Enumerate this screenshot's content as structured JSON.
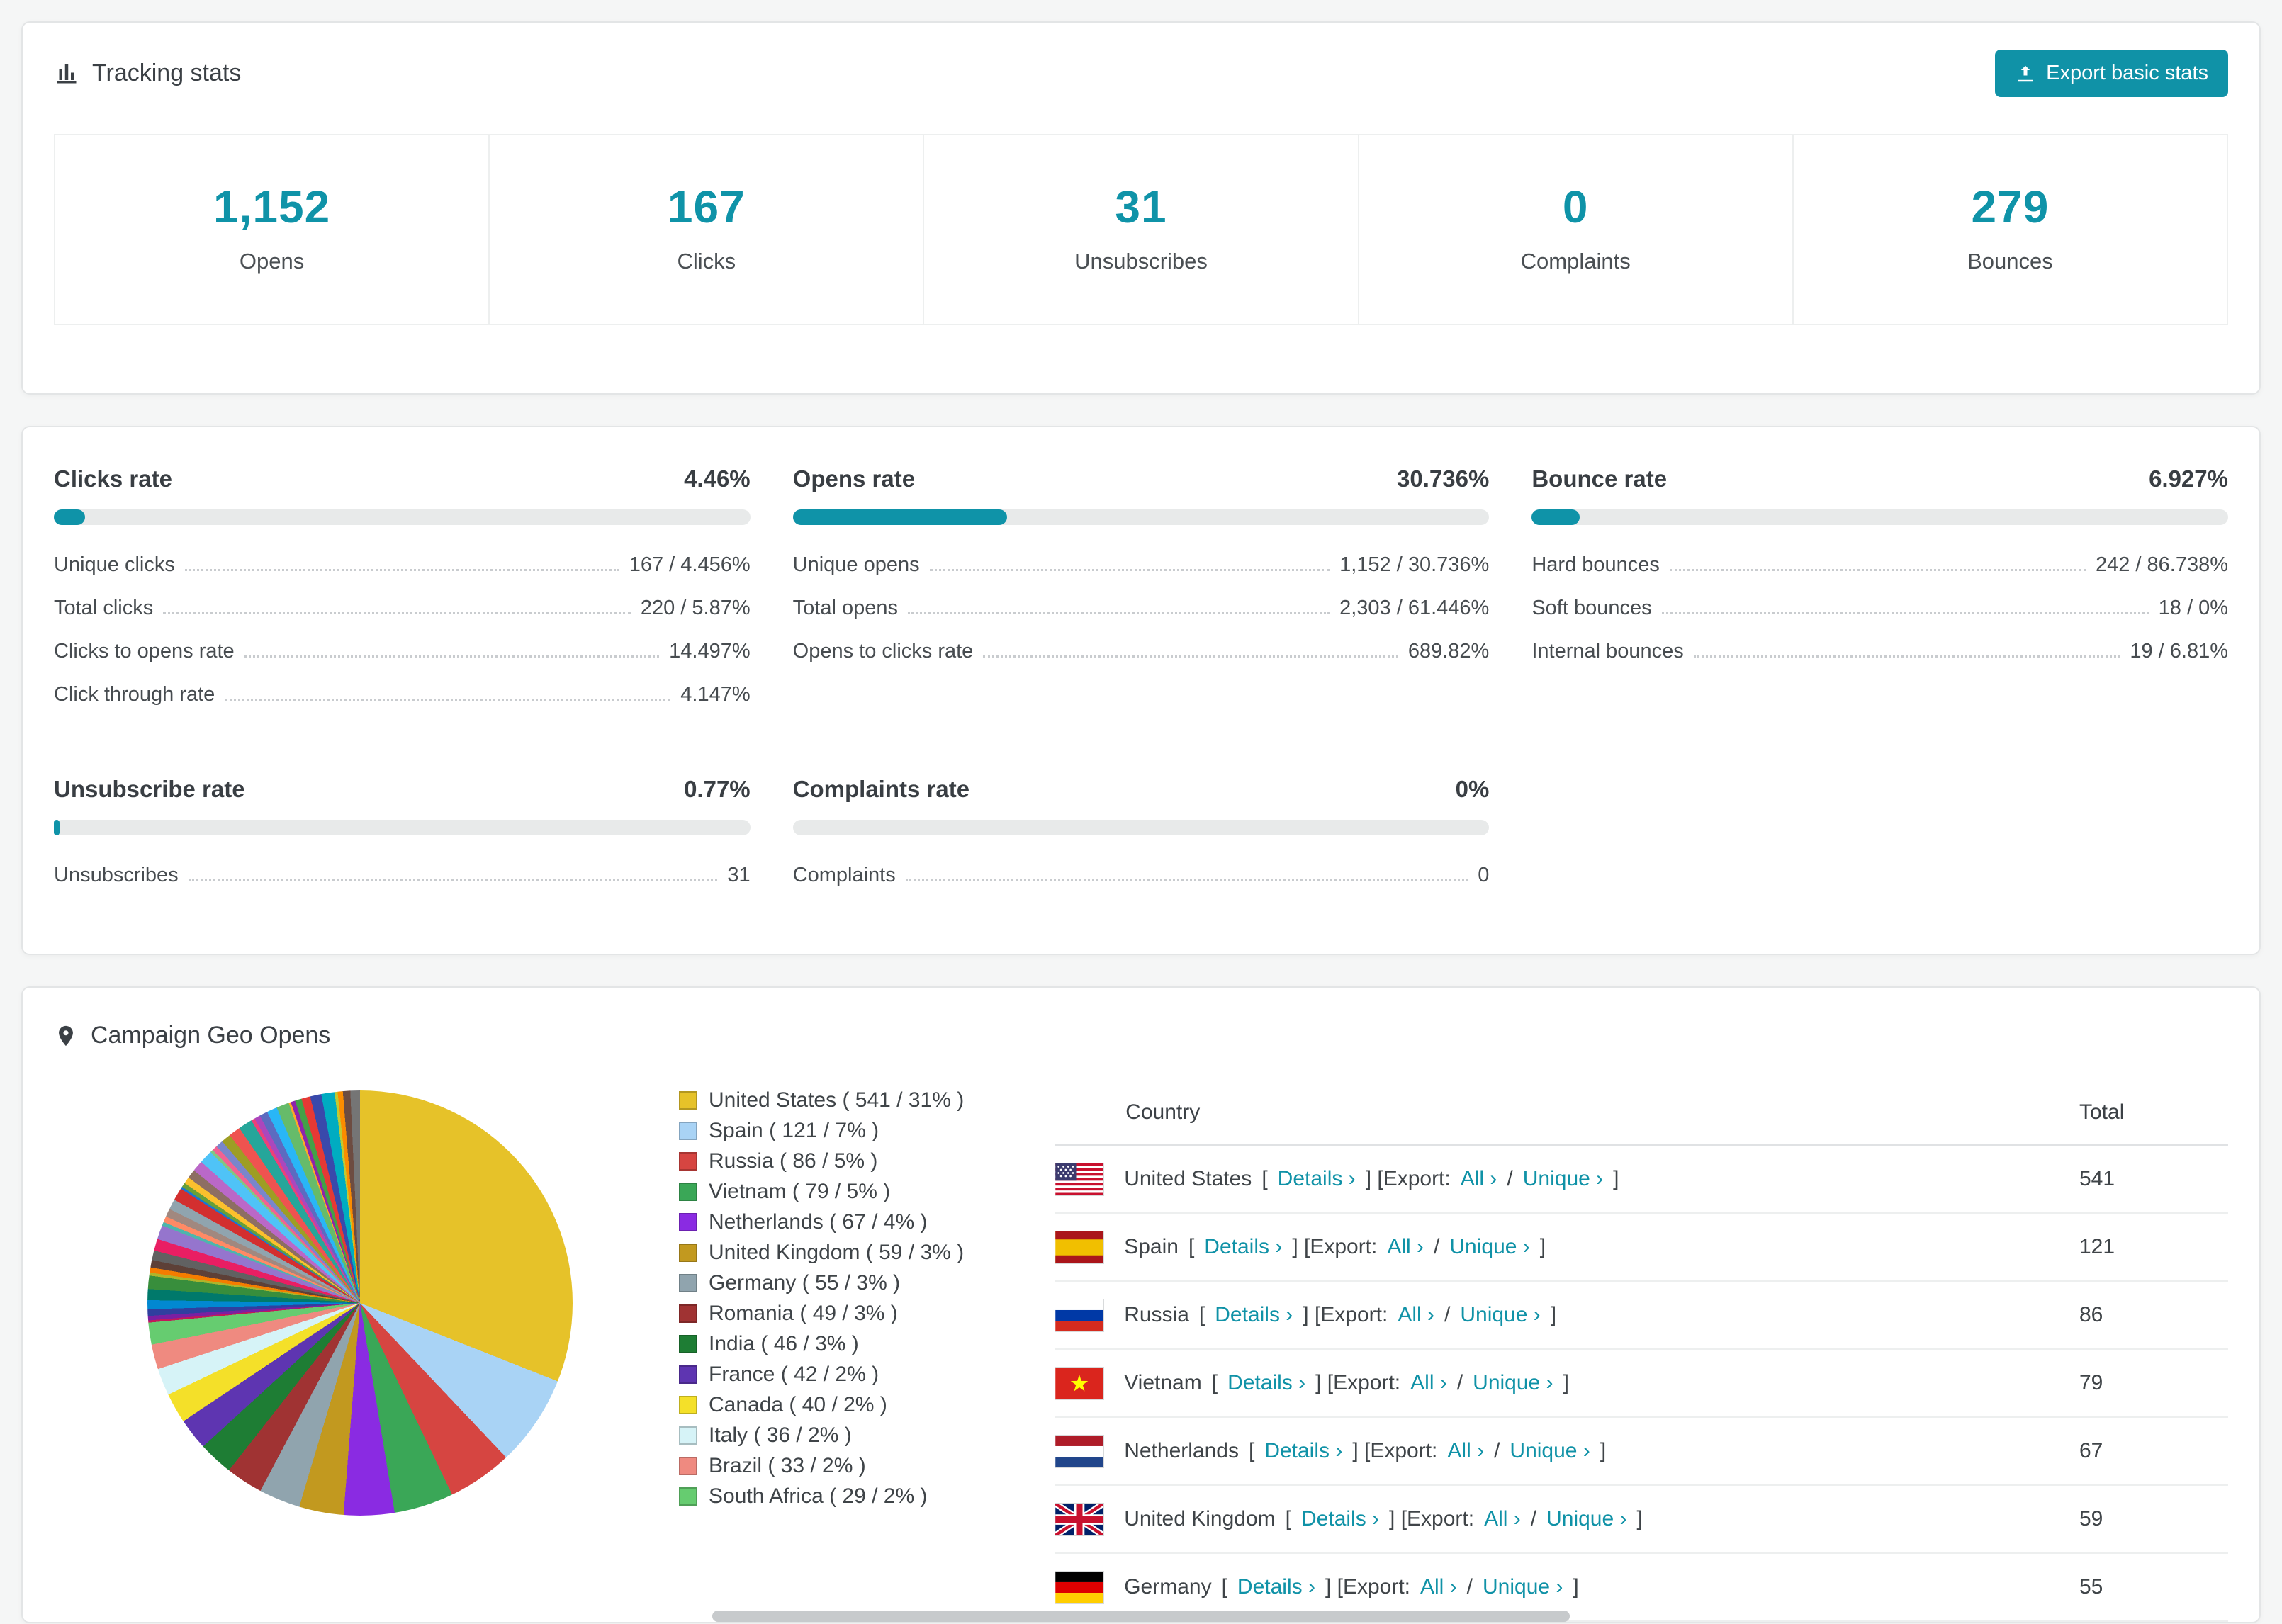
{
  "accent_color": "#1092a7",
  "tracking": {
    "title": "Tracking stats",
    "export_label": "Export basic stats",
    "stats": [
      {
        "value": "1,152",
        "label": "Opens"
      },
      {
        "value": "167",
        "label": "Clicks"
      },
      {
        "value": "31",
        "label": "Unsubscribes"
      },
      {
        "value": "0",
        "label": "Complaints"
      },
      {
        "value": "279",
        "label": "Bounces"
      }
    ]
  },
  "rates": [
    {
      "title": "Clicks rate",
      "percent_label": "4.46%",
      "percent": 4.46,
      "rows": [
        {
          "label": "Unique clicks",
          "value": "167 / 4.456%"
        },
        {
          "label": "Total clicks",
          "value": "220 / 5.87%"
        },
        {
          "label": "Clicks to opens rate",
          "value": "14.497%"
        },
        {
          "label": "Click through rate",
          "value": "4.147%"
        }
      ]
    },
    {
      "title": "Opens rate",
      "percent_label": "30.736%",
      "percent": 30.736,
      "rows": [
        {
          "label": "Unique opens",
          "value": "1,152 / 30.736%"
        },
        {
          "label": "Total opens",
          "value": "2,303 / 61.446%"
        },
        {
          "label": "Opens to clicks rate",
          "value": "689.82%"
        }
      ]
    },
    {
      "title": "Bounce rate",
      "percent_label": "6.927%",
      "percent": 6.927,
      "rows": [
        {
          "label": "Hard bounces",
          "value": "242 / 86.738%"
        },
        {
          "label": "Soft bounces",
          "value": "18 / 0%"
        },
        {
          "label": "Internal bounces",
          "value": "19 / 6.81%"
        }
      ]
    },
    {
      "title": "Unsubscribe rate",
      "percent_label": "0.77%",
      "percent": 0.77,
      "rows": [
        {
          "label": "Unsubscribes",
          "value": "31"
        }
      ]
    },
    {
      "title": "Complaints rate",
      "percent_label": "0%",
      "percent": 0,
      "rows": [
        {
          "label": "Complaints",
          "value": "0"
        }
      ]
    }
  ],
  "geo": {
    "title": "Campaign Geo Opens",
    "chart_data": {
      "type": "pie",
      "title": "Campaign Geo Opens",
      "categories": [
        "United States",
        "Spain",
        "Russia",
        "Vietnam",
        "Netherlands",
        "United Kingdom",
        "Germany",
        "Romania",
        "India",
        "France",
        "Canada",
        "Italy",
        "Brazil",
        "South Africa"
      ],
      "values": [
        541,
        121,
        86,
        79,
        67,
        59,
        55,
        49,
        46,
        42,
        40,
        36,
        33,
        29
      ],
      "percents": [
        31,
        7,
        5,
        5,
        4,
        3,
        3,
        3,
        3,
        2,
        2,
        2,
        2,
        2
      ],
      "colors": [
        "#e6c229",
        "#a9d3f5",
        "#d64541",
        "#3aa757",
        "#8a2be2",
        "#c2991f",
        "#90a4ae",
        "#a03333",
        "#1e7d34",
        "#5e35b1",
        "#f4e029",
        "#d6f3f7",
        "#ef8a80",
        "#66cc70"
      ],
      "legend_position": "right",
      "start_angle_deg": 0,
      "other": {
        "total": 462,
        "slice_count": 44,
        "note": "many small unlabeled slices"
      },
      "other_palette": [
        "#c2185b",
        "#7b1fa2",
        "#303f9f",
        "#0288d1",
        "#00796b",
        "#388e3c",
        "#afb42b",
        "#f57c00",
        "#5d4037",
        "#616161",
        "#e91e63",
        "#9575cd",
        "#4db6ac",
        "#ff8a65",
        "#a1887f",
        "#90a4ae",
        "#d32f2f",
        "#1976d2",
        "#689f38",
        "#fbc02d",
        "#8d6e63",
        "#ba68c8",
        "#4fc3f7",
        "#81c784",
        "#f06292",
        "#7986cb",
        "#9e9d24",
        "#ef5350",
        "#26a69a",
        "#ec407a",
        "#ab47bc",
        "#5c6bc0",
        "#29b6f6",
        "#66bb6a",
        "#ffa726",
        "#8e24aa",
        "#43a047",
        "#e53935",
        "#3949ab",
        "#00acc1",
        "#c0ca33",
        "#fb8c00",
        "#6d4c41",
        "#757575"
      ]
    },
    "table": {
      "headers": [
        "Country",
        "Total"
      ],
      "labels": {
        "open_bracket": "[",
        "details": "Details ›",
        "close_then_export": "] [Export:",
        "all": "All ›",
        "slash": "/",
        "unique": "Unique ›",
        "close_bracket": "]"
      },
      "rows": [
        {
          "country": "United States",
          "flag": "us",
          "total": "541"
        },
        {
          "country": "Spain",
          "flag": "es",
          "total": "121"
        },
        {
          "country": "Russia",
          "flag": "ru",
          "total": "86"
        },
        {
          "country": "Vietnam",
          "flag": "vn",
          "total": "79"
        },
        {
          "country": "Netherlands",
          "flag": "nl",
          "total": "67"
        },
        {
          "country": "United Kingdom",
          "flag": "gb",
          "total": "59"
        },
        {
          "country": "Germany",
          "flag": "de",
          "total": "55"
        }
      ]
    }
  }
}
